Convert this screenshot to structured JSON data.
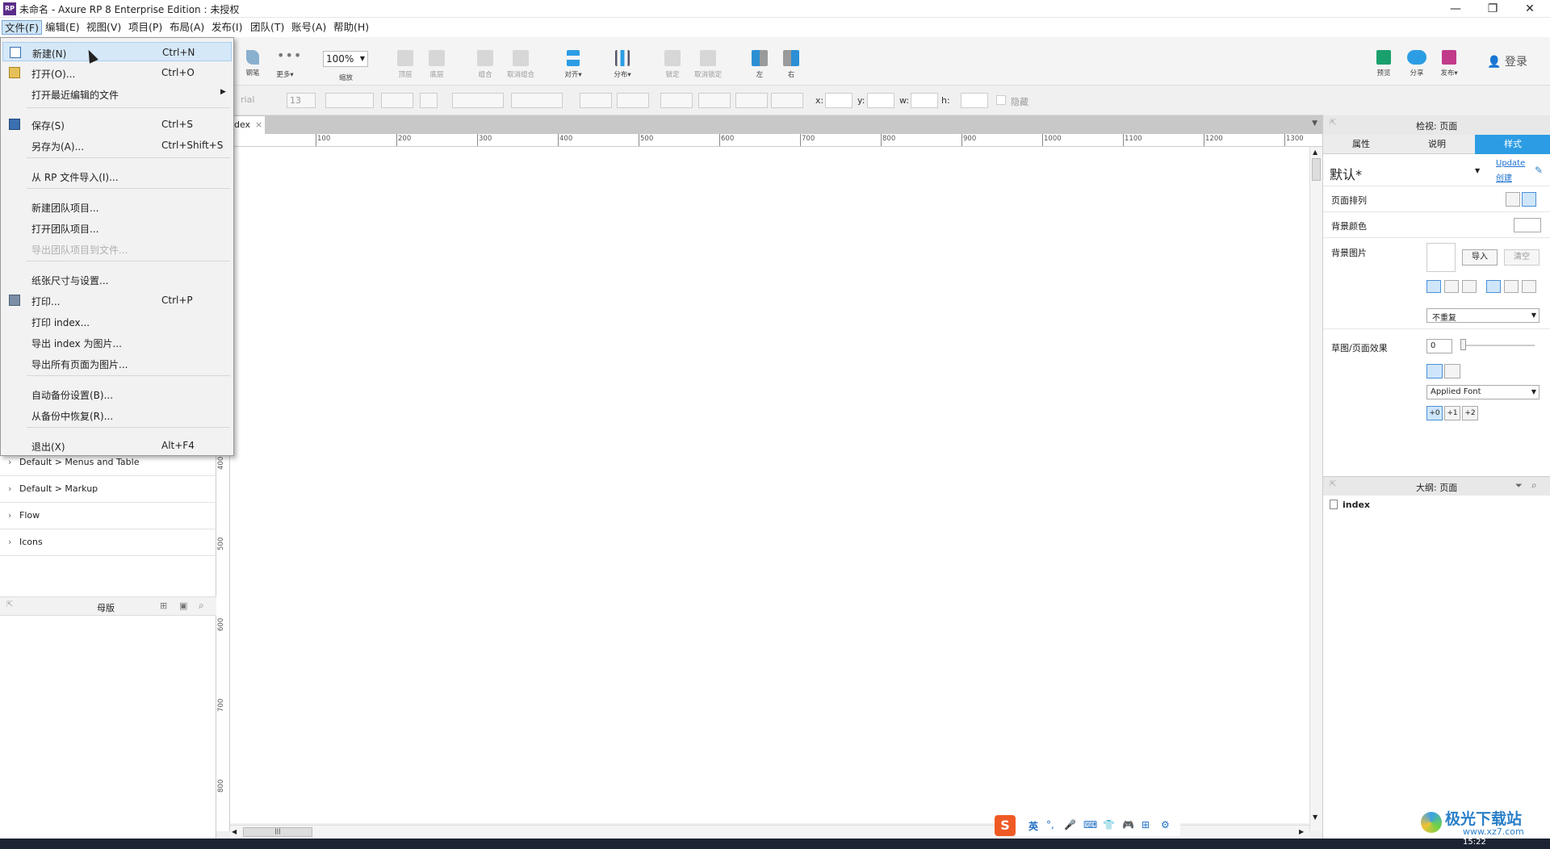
{
  "window": {
    "title": "未命名 - Axure RP 8 Enterprise Edition : 未授权",
    "app_icon": "RP",
    "controls": [
      "—",
      "❐",
      "✕"
    ]
  },
  "menubar": [
    "文件(F)",
    "编辑(E)",
    "视图(V)",
    "项目(P)",
    "布局(A)",
    "发布(I)",
    "团队(T)",
    "账号(A)",
    "帮助(H)"
  ],
  "toolbar": {
    "pen": "钢笔",
    "more": "更多▾",
    "zoom_value": "100%",
    "zoom_label": "缩放",
    "top": "顶层",
    "bottom": "底层",
    "group": "组合",
    "ungroup": "取消组合",
    "align": "对齐▾",
    "distribute": "分布▾",
    "lock": "锁定",
    "unlock": "取消锁定",
    "left": "左",
    "right": "右",
    "preview": "预览",
    "share": "分享",
    "publish": "发布▾",
    "login": "登录"
  },
  "formatbar": {
    "font": "rial",
    "size": "13",
    "x_label": "x:",
    "y_label": "y:",
    "w_label": "w:",
    "h_label": "h:",
    "hidden_label": "隐藏"
  },
  "page_tab": "dex",
  "ruler_top": [
    "100",
    "200",
    "300",
    "400",
    "500",
    "600",
    "700",
    "800",
    "900",
    "1000",
    "1100",
    "1200",
    "1300"
  ],
  "ruler_left": [
    "400",
    "500",
    "600",
    "700",
    "800"
  ],
  "libraries": [
    "Default > Menus and Table",
    "Default > Markup",
    "Flow",
    "Icons"
  ],
  "masters_title": "母版",
  "inspector": {
    "header": "检视: 页面",
    "tabs": [
      "属性",
      "说明",
      "样式"
    ],
    "style_name": "默认*",
    "update_link": "Update",
    "create_link": "创建",
    "page_align": "页面排列",
    "bg_color": "背景颜色",
    "bg_image": "背景图片",
    "import_btn": "导入",
    "clear_btn": "清空",
    "repeat_value": "不重复",
    "sketch_effect": "草图/页面效果",
    "sketch_value": "0",
    "font_value": "Applied Font",
    "font_steps": [
      "+0",
      "+1",
      "+2"
    ]
  },
  "outline": {
    "header": "大纲: 页面",
    "page": "index"
  },
  "file_menu": [
    {
      "label": "新建(N)",
      "shortcut": "Ctrl+N",
      "icon": "new-file-icon",
      "highlight": true
    },
    {
      "label": "打开(O)...",
      "shortcut": "Ctrl+O",
      "icon": "open-folder-icon"
    },
    {
      "label": "打开最近编辑的文件",
      "shortcut": "",
      "submenu": true
    },
    {
      "label": "保存(S)",
      "shortcut": "Ctrl+S",
      "icon": "save-icon"
    },
    {
      "label": "另存为(A)...",
      "shortcut": "Ctrl+Shift+S"
    },
    {
      "label": "从 RP 文件导入(I)...",
      "shortcut": ""
    },
    {
      "label": "新建团队项目...",
      "shortcut": ""
    },
    {
      "label": "打开团队项目...",
      "shortcut": ""
    },
    {
      "label": "导出团队项目到文件...",
      "shortcut": "",
      "disabled": true
    },
    {
      "label": "纸张尺寸与设置...",
      "shortcut": ""
    },
    {
      "label": "打印...",
      "shortcut": "Ctrl+P",
      "icon": "printer-icon"
    },
    {
      "label": "打印 index...",
      "shortcut": ""
    },
    {
      "label": "导出 index 为图片...",
      "shortcut": ""
    },
    {
      "label": "导出所有页面为图片...",
      "shortcut": ""
    },
    {
      "label": "自动备份设置(B)...",
      "shortcut": ""
    },
    {
      "label": "从备份中恢复(R)...",
      "shortcut": ""
    },
    {
      "label": "退出(X)",
      "shortcut": "Alt+F4"
    }
  ],
  "ime": [
    "英",
    "°,",
    "🎤",
    "⌨",
    "👕",
    "🎮",
    "⊞",
    "⚙"
  ],
  "ime_logo": "S",
  "watermark": {
    "title": "极光下载站",
    "url": "www.xz7.com"
  },
  "taskbar_time": "15:22",
  "colors": {
    "accent": "#2c9de4",
    "menu_highlight": "#d5e8f8",
    "brand": "#5b2d8a"
  }
}
